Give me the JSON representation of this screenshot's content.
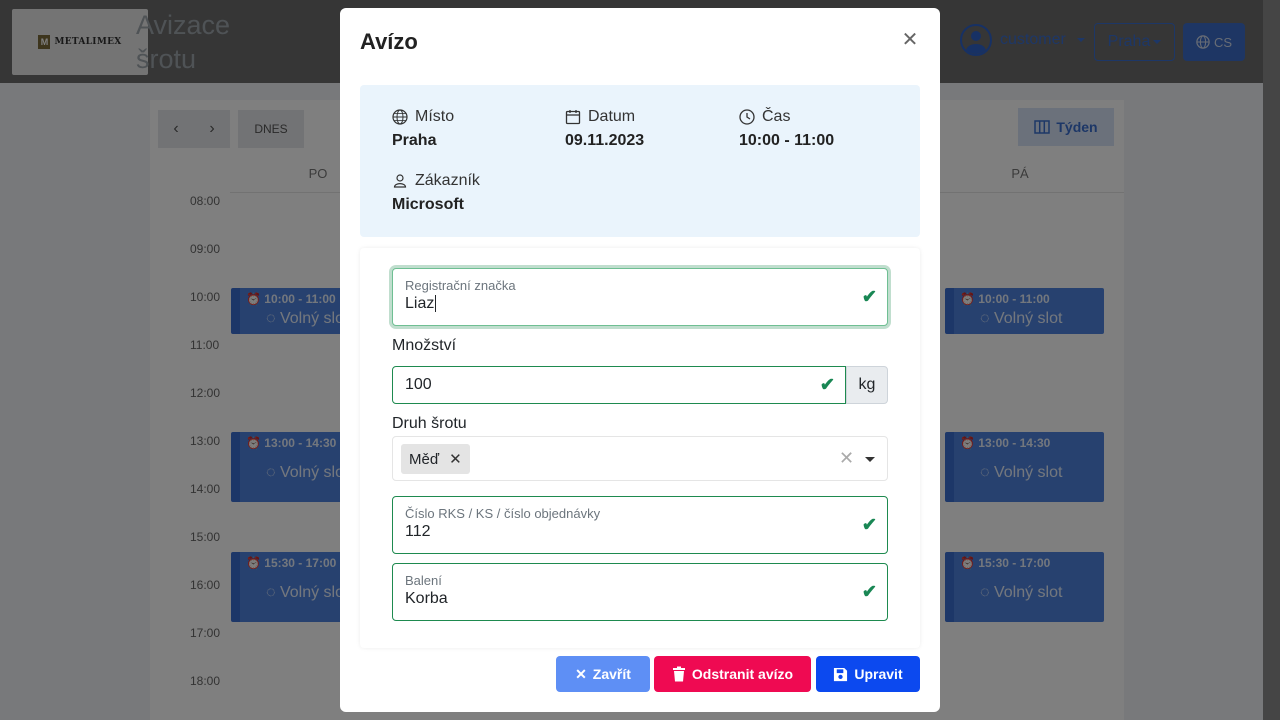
{
  "app": {
    "logo_text": "METALIMEX",
    "title_line1": "Avizace",
    "title_line2": "šrotu",
    "user": "customer",
    "location_btn": "Praha",
    "lang_btn": "CS"
  },
  "calendar": {
    "today_btn": "DNES",
    "week_btn": "Týden",
    "days": [
      "PO",
      "PÁ"
    ],
    "hours": [
      "08:00",
      "09:00",
      "10:00",
      "11:00",
      "12:00",
      "13:00",
      "14:00",
      "15:00",
      "16:00",
      "17:00",
      "18:00"
    ],
    "events": [
      {
        "time": "10:00 - 11:00",
        "label": "Volný slot"
      },
      {
        "time": "13:00 - 14:30",
        "label": "Volný slot"
      },
      {
        "time": "15:30 - 17:00",
        "label": "Volný slot"
      }
    ]
  },
  "modal": {
    "title": "Avízo",
    "info": {
      "place_label": "Místo",
      "place_value": "Praha",
      "date_label": "Datum",
      "date_value": "09.11.2023",
      "time_label": "Čas",
      "time_value": "10:00 - 11:00",
      "customer_label": "Zákazník",
      "customer_value": "Microsoft"
    },
    "form": {
      "plate_label": "Registrační značka",
      "plate_value": "Liaz",
      "qty_label": "Množství",
      "qty_value": "100",
      "qty_unit": "kg",
      "scrap_label": "Druh šrotu",
      "scrap_chip": "Měď",
      "rks_label": "Číslo RKS / KS / číslo objednávky",
      "rks_value": "112",
      "pack_label": "Balení",
      "pack_value": "Korba"
    },
    "buttons": {
      "close": "Zavřít",
      "delete": "Odstranit avízo",
      "save": "Upravit"
    }
  },
  "colors": {
    "primary": "#0c49ef",
    "danger": "#ef0a52",
    "close": "#5e8ff5",
    "valid": "#198754",
    "info_bg": "#eaf4fc"
  }
}
